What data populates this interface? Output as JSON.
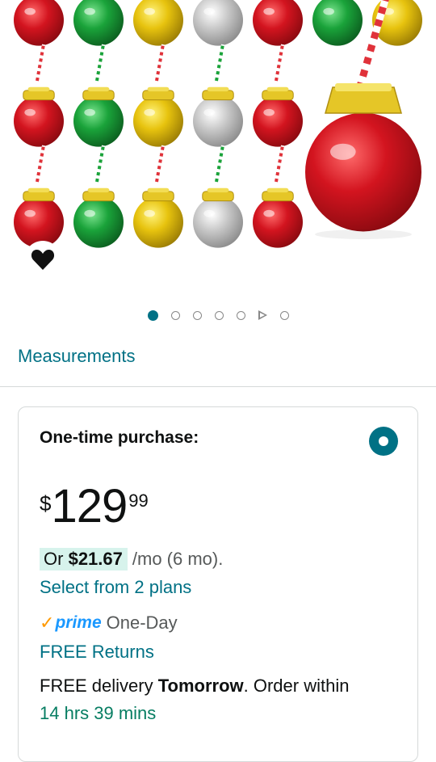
{
  "gallery": {
    "image_alt": "Christmas ornament ball cups with straws in red, green, gold and silver",
    "ornament_colors": {
      "red": "#d3141f",
      "green": "#1aa33a",
      "gold": "#e7c30e",
      "silver": "#c9c9c9",
      "cap": "#e5c627"
    },
    "wishlist_icon": "heart-icon",
    "page_count": 7,
    "active_page": 1,
    "video_page": 6
  },
  "measurements_label": "Measurements",
  "purchase": {
    "title": "One-time purchase:",
    "selected": true,
    "price_symbol": "$",
    "price_whole": "129",
    "price_fraction": "99",
    "monthly_prefix": "Or",
    "monthly_amount": "$21.67",
    "monthly_suffix": "/mo (6 mo).",
    "plans_link": "Select from 2 plans",
    "prime_check": "✓",
    "prime_word": "prime",
    "prime_speed": "One-Day",
    "returns_link": "FREE Returns",
    "delivery_prefix": "FREE delivery",
    "delivery_day": "Tomorrow",
    "delivery_middle": ". Order within",
    "delivery_countdown": "14 hrs 39 mins"
  },
  "colors": {
    "link": "#007185",
    "highlight": "#d7f3ec",
    "countdown": "#067d62",
    "prime_check": "#ff9900",
    "prime_word": "#1a98ff"
  }
}
